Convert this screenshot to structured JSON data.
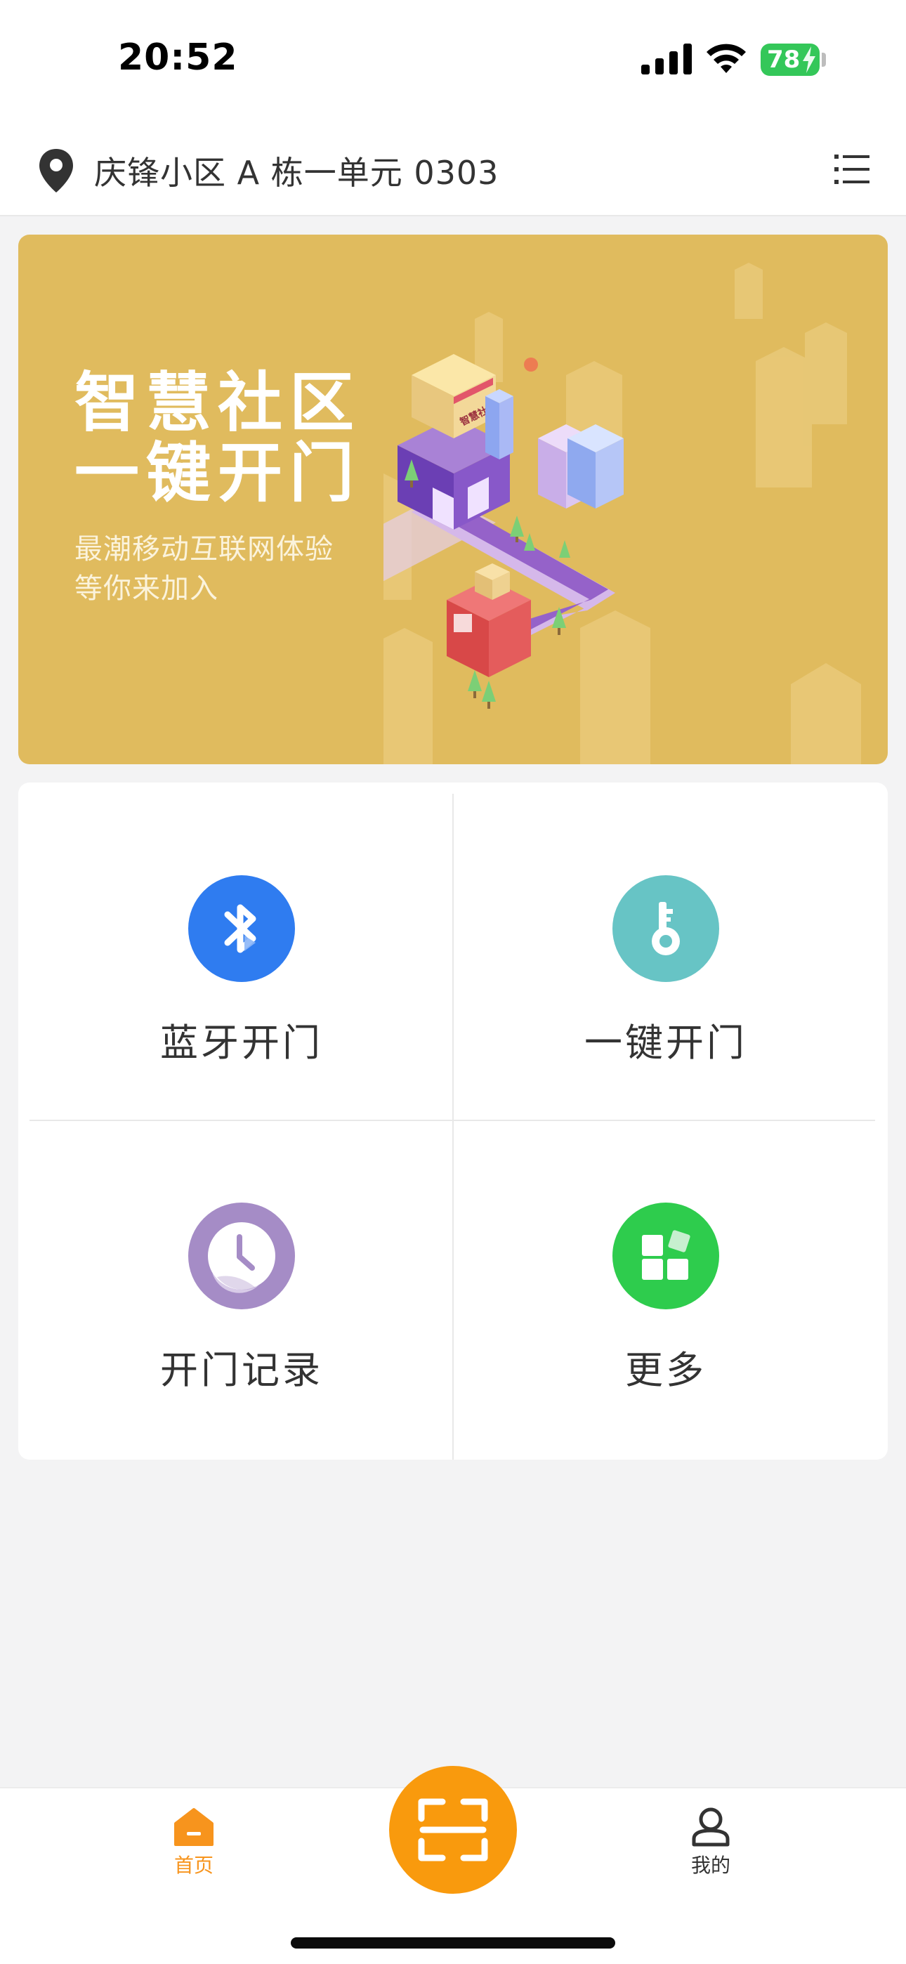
{
  "status_bar": {
    "time": "20:52",
    "battery": "78",
    "icons": [
      "signal-icon",
      "wifi-icon",
      "battery-charging-icon"
    ]
  },
  "header": {
    "location": "庆锋小区 A 栋一单元 0303",
    "pin_icon": "location-pin-icon",
    "menu_icon": "list-menu-icon"
  },
  "banner": {
    "title_line1": "智慧社区",
    "title_line2": "一键开门",
    "subtitle_line1": "最潮移动互联网体验",
    "subtitle_line2": "等你来加入",
    "sign_text": "智慧社区",
    "background": "#e0bb5e"
  },
  "actions": [
    {
      "label": "蓝牙开门",
      "icon": "bluetooth-icon",
      "color": "#2f7cf0"
    },
    {
      "label": "一键开门",
      "icon": "key-icon",
      "color": "#67c4c5"
    },
    {
      "label": "开门记录",
      "icon": "clock-icon",
      "color": "#a58cc6"
    },
    {
      "label": "更多",
      "icon": "grid-more-icon",
      "color": "#2ecc4d"
    }
  ],
  "tabbar": {
    "home_label": "首页",
    "mine_label": "我的",
    "scan_icon": "scan-icon",
    "active_color": "#f7941d",
    "scan_color": "#f99a0d"
  }
}
